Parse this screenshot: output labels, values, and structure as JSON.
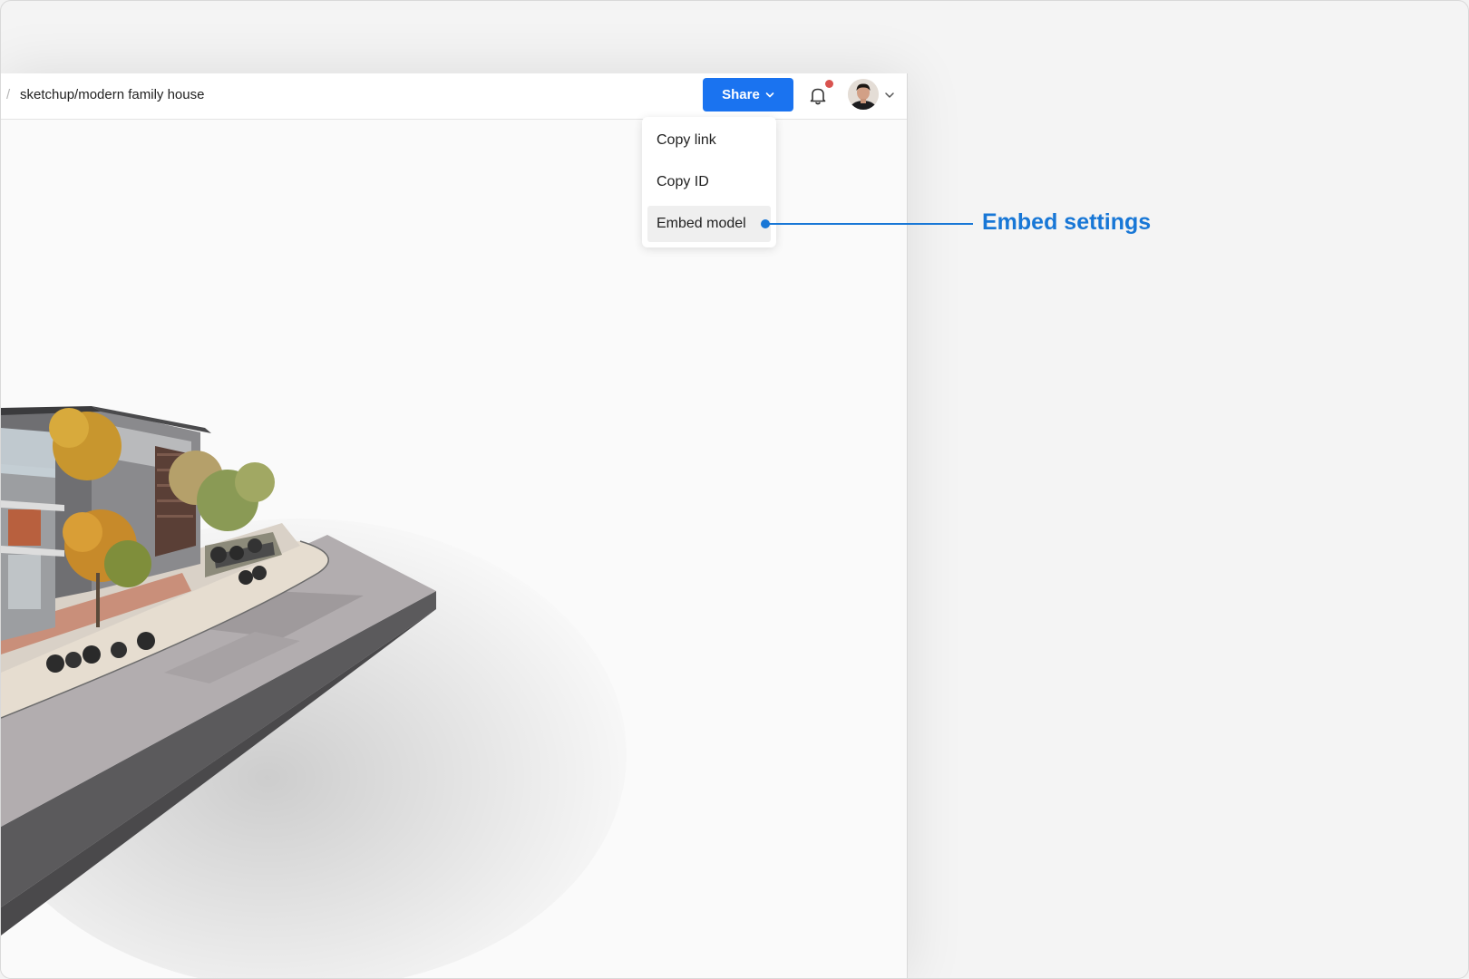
{
  "breadcrumb": {
    "separator": "/",
    "path": "sketchup/modern family house"
  },
  "toolbar": {
    "share_label": "Share"
  },
  "share_menu": {
    "items": [
      {
        "label": "Copy link",
        "active": false
      },
      {
        "label": "Copy ID",
        "active": false
      },
      {
        "label": "Embed model",
        "active": true
      }
    ]
  },
  "callout": {
    "text": "Embed settings"
  },
  "colors": {
    "accent": "#1a73f0",
    "callout": "#1877d6",
    "notification_dot": "#d9534f"
  },
  "icons": {
    "notifications": "bell-icon",
    "share_caret": "chevron-down-icon",
    "account_caret": "chevron-down-icon"
  }
}
